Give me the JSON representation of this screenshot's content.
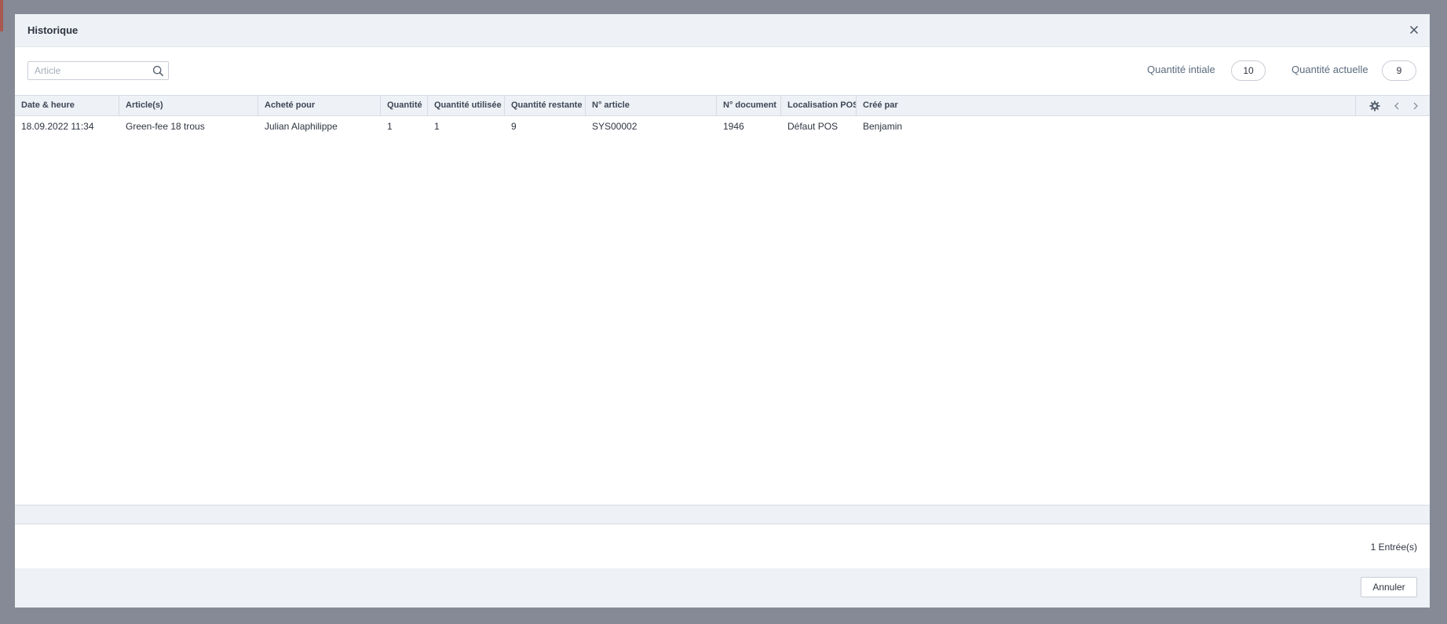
{
  "dialog": {
    "title": "Historique",
    "close_icon": "close-icon"
  },
  "search": {
    "placeholder": "Article",
    "icon": "search-icon"
  },
  "quantities": {
    "initial_label": "Quantité intiale",
    "initial_value": "10",
    "current_label": "Quantité actuelle",
    "current_value": "9"
  },
  "table": {
    "columns": [
      "Date & heure",
      "Article(s)",
      "Acheté pour",
      "Quantité",
      "Quantité utilisée",
      "Quantité restante",
      "N° article",
      "N° document",
      "Localisation POS",
      "Créé par"
    ],
    "rows": [
      [
        "18.09.2022 11:34",
        "Green-fee 18 trous",
        "Julian Alaphilippe",
        "1",
        "1",
        "9",
        "SYS00002",
        "1946",
        "Défaut POS",
        "Benjamin"
      ]
    ],
    "tools": [
      "gear-icon",
      "chevron-left-icon",
      "chevron-right-icon"
    ]
  },
  "footer": {
    "entries": "1 Entrée(s)",
    "cancel_label": "Annuler"
  },
  "colors": {
    "backdrop": "#858a96",
    "header_bg": "#eef1f5",
    "border": "#d7dce3",
    "text": "#2e3440",
    "muted": "#5b6b7e"
  }
}
